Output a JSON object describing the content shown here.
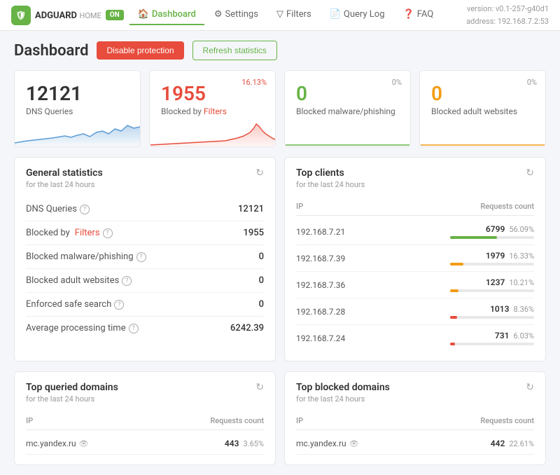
{
  "header": {
    "logo_text": "ADGUARD",
    "logo_sub": "HOME",
    "on_badge": "ON",
    "version": "version: v0.1-257-g40d1",
    "address": "address: 192.168.7.2:53",
    "nav": [
      {
        "id": "dashboard",
        "label": "Dashboard",
        "active": true,
        "icon": "🏠"
      },
      {
        "id": "settings",
        "label": "Settings",
        "active": false,
        "icon": "⚙"
      },
      {
        "id": "filters",
        "label": "Filters",
        "active": false,
        "icon": "▽"
      },
      {
        "id": "query-log",
        "label": "Query Log",
        "active": false,
        "icon": "📄"
      },
      {
        "id": "faq",
        "label": "FAQ",
        "active": false,
        "icon": "❓"
      }
    ]
  },
  "page": {
    "title": "Dashboard",
    "disable_btn": "Disable protection",
    "refresh_btn": "Refresh statistics"
  },
  "stats_cards": [
    {
      "id": "dns-queries",
      "number": "12121",
      "label": "DNS Queries",
      "percentage": "",
      "number_color": "default",
      "chart_color": "#5b9bd5"
    },
    {
      "id": "blocked-filters",
      "number": "1955",
      "label": "Blocked by Filters",
      "percentage": "16.13%",
      "number_color": "red",
      "chart_color": "#e74c3c"
    },
    {
      "id": "blocked-malware",
      "number": "0",
      "label": "Blocked malware/phishing",
      "percentage": "0%",
      "number_color": "green",
      "chart_color": "#67b346"
    },
    {
      "id": "blocked-adult",
      "number": "0",
      "label": "Blocked adult websites",
      "percentage": "0%",
      "number_color": "yellow",
      "chart_color": "#f39c12"
    }
  ],
  "general_stats": {
    "title": "General statistics",
    "subtitle": "for the last 24 hours",
    "rows": [
      {
        "label": "DNS Queries",
        "value": "12121",
        "has_help": true,
        "link": null
      },
      {
        "label": "Blocked by",
        "value": "1955",
        "has_help": true,
        "link": "Filters"
      },
      {
        "label": "Blocked malware/phishing",
        "value": "0",
        "has_help": true,
        "link": null
      },
      {
        "label": "Blocked adult websites",
        "value": "0",
        "has_help": true,
        "link": null
      },
      {
        "label": "Enforced safe search",
        "value": "0",
        "has_help": true,
        "link": null
      },
      {
        "label": "Average processing time",
        "value": "6242.39",
        "has_help": true,
        "link": null
      }
    ]
  },
  "top_clients": {
    "title": "Top clients",
    "subtitle": "for the last 24 hours",
    "col_ip": "IP",
    "col_count": "Requests count",
    "clients": [
      {
        "ip": "192.168.7.21",
        "count": "6799",
        "percent": "56.09%",
        "bar_pct": 56,
        "bar_color": "#67b346"
      },
      {
        "ip": "192.168.7.39",
        "count": "1979",
        "percent": "16.33%",
        "bar_pct": 16,
        "bar_color": "#f39c12"
      },
      {
        "ip": "192.168.7.36",
        "count": "1237",
        "percent": "10.21%",
        "bar_pct": 10,
        "bar_color": "#f39c12"
      },
      {
        "ip": "192.168.7.28",
        "count": "1013",
        "percent": "8.36%",
        "bar_pct": 8,
        "bar_color": "#e74c3c"
      },
      {
        "ip": "192.168.7.24",
        "count": "731",
        "percent": "6.03%",
        "bar_pct": 6,
        "bar_color": "#e74c3c"
      }
    ]
  },
  "top_queried": {
    "title": "Top queried domains",
    "subtitle": "for the last 24 hours",
    "col_ip": "IP",
    "col_count": "Requests count",
    "domains": [
      {
        "name": "mc.yandex.ru",
        "count": "443",
        "percent": "3.65%"
      }
    ]
  },
  "top_blocked": {
    "title": "Top blocked domains",
    "subtitle": "for the last 24 hours",
    "col_ip": "IP",
    "col_count": "Requests count",
    "domains": [
      {
        "name": "mc.yandex.ru",
        "count": "442",
        "percent": "22.61%"
      }
    ]
  }
}
